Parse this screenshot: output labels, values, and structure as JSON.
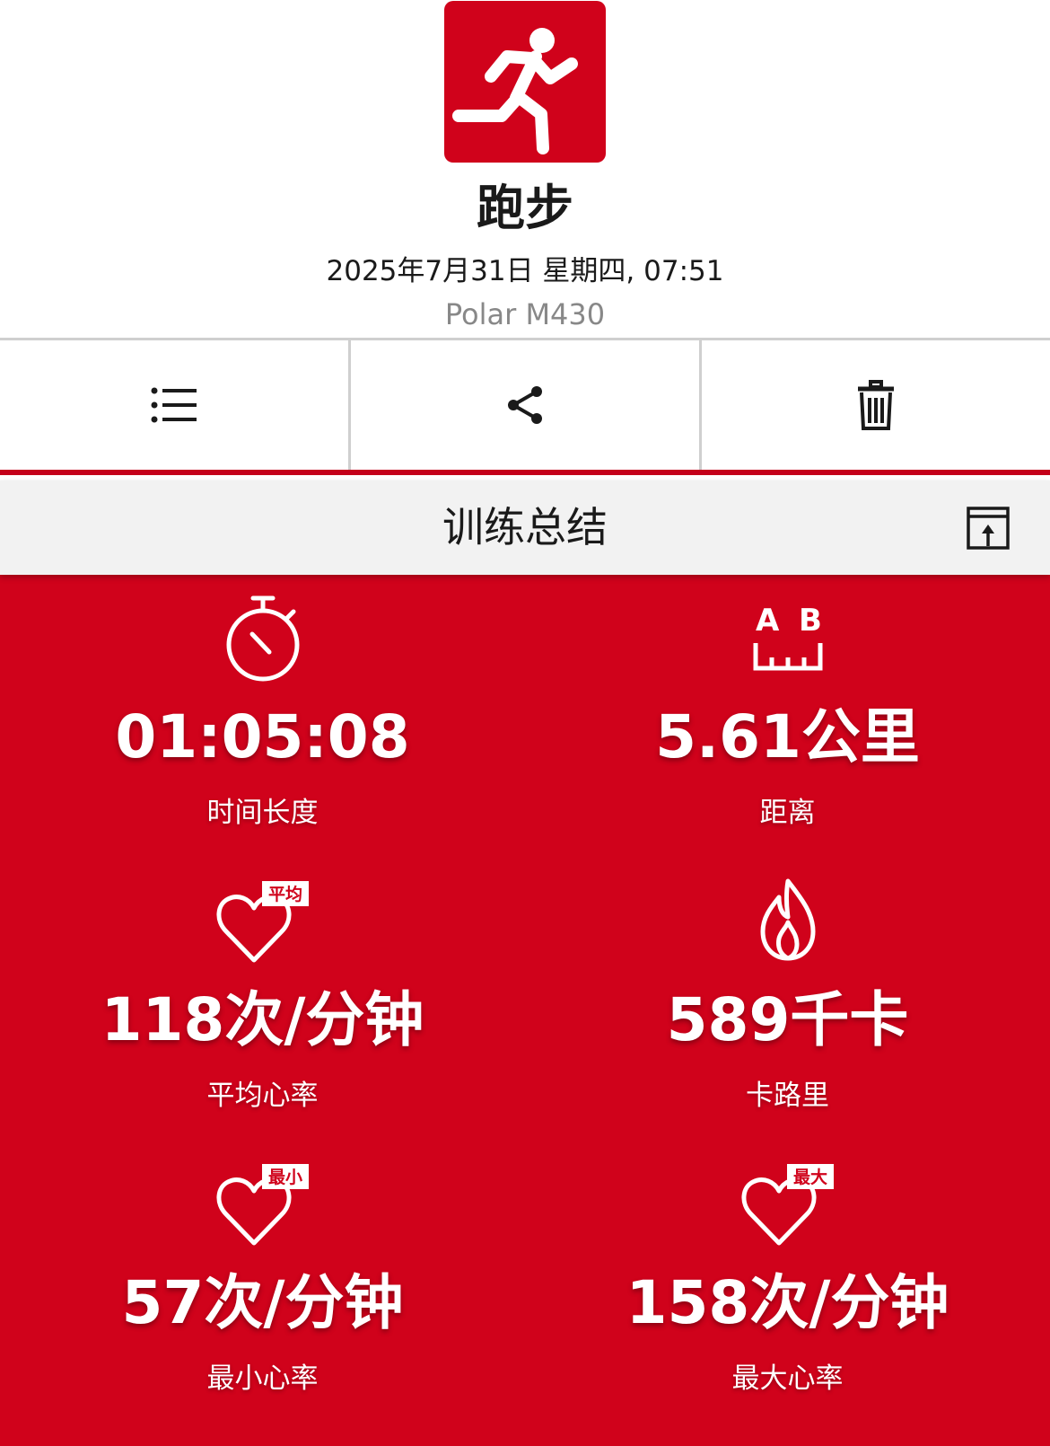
{
  "header": {
    "sport_name": "跑步",
    "session_datetime": "2025年7月31日 星期四, 07:51",
    "device": "Polar M430",
    "sport_icon": "running-person-icon",
    "brand_color": "#d0021b"
  },
  "toolbar": {
    "buttons": [
      {
        "icon": "list-icon"
      },
      {
        "icon": "share-icon"
      },
      {
        "icon": "trash-icon"
      }
    ]
  },
  "section": {
    "title": "训练总结",
    "action_icon": "export-icon"
  },
  "stats": [
    {
      "icon": "stopwatch-icon",
      "value": "01:05:08",
      "label": "时间长度"
    },
    {
      "icon": "distance-ab-icon",
      "icon_text_a": "A",
      "icon_text_b": "B",
      "value": "5.61公里",
      "label": "距离"
    },
    {
      "icon": "heart-avg-icon",
      "icon_badge": "平均",
      "value": "118次/分钟",
      "label": "平均心率"
    },
    {
      "icon": "flame-icon",
      "value": "589千卡",
      "label": "卡路里"
    },
    {
      "icon": "heart-min-icon",
      "icon_badge": "最小",
      "value": "57次/分钟",
      "label": "最小心率"
    },
    {
      "icon": "heart-max-icon",
      "icon_badge": "最大",
      "value": "158次/分钟",
      "label": "最大心率"
    }
  ]
}
